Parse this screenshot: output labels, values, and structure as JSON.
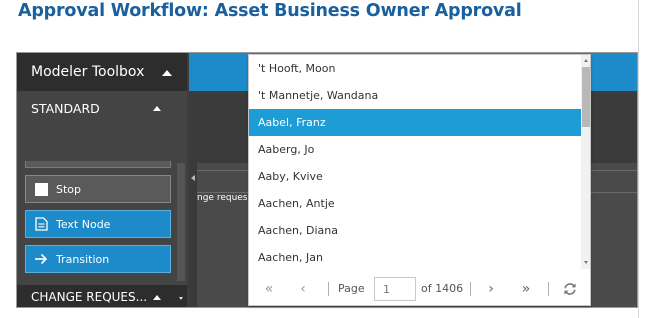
{
  "page": {
    "heading": "Approval Workflow: Asset Business Owner Approval"
  },
  "toolbox": {
    "title": "Modeler Toolbox",
    "standard_label": "STANDARD",
    "tools": {
      "stop": "Stop",
      "text_node": "Text Node",
      "transition": "Transition"
    },
    "change_section_label": "CHANGE REQUES..."
  },
  "canvas": {
    "snippet": "nge reques"
  },
  "dropdown": {
    "items": [
      "'t Hooft, Moon",
      "'t Mannetje, Wandana",
      "Aabel, Franz",
      "Aaberg, Jo",
      "Aaby, Kvive",
      "Aachen, Antje",
      "Aachen, Diana",
      "Aachen, Jan"
    ],
    "selected_item": "Aabel, Franz",
    "pager": {
      "first": "«",
      "prev": "‹",
      "page_label": "Page",
      "current_page": "1",
      "of_label": "of 1406",
      "next": "›",
      "last": "»"
    }
  },
  "colors": {
    "heading": "#1a5f9e",
    "accent_blue": "#1d8bc9",
    "selection_blue": "#1d9cd6",
    "toolbox_bg": "#444444",
    "toolbox_header_bg": "#2d2d2d"
  },
  "icons": {
    "toolbox_collapse": "caret-up-icon",
    "stop": "stop-square-icon",
    "text_node": "document-icon",
    "transition": "arrow-right-icon",
    "refresh": "refresh-icon"
  }
}
